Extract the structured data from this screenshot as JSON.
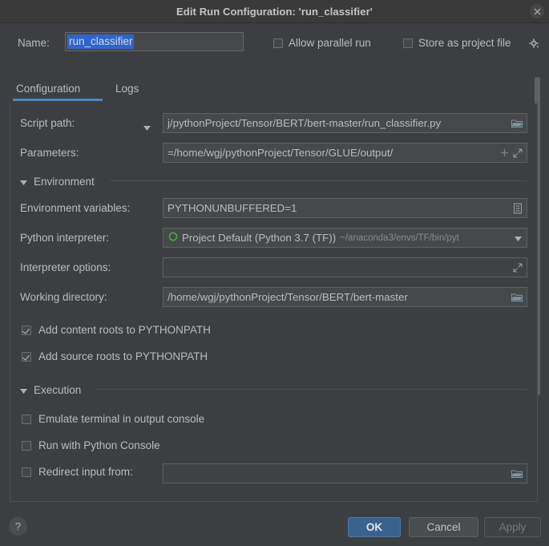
{
  "window": {
    "title": "Edit Run Configuration: 'run_classifier'",
    "close_icon": "close-icon"
  },
  "name_row": {
    "label": "Name:",
    "value": "run_classifier",
    "allow_parallel": {
      "label": "Allow parallel run",
      "checked": false
    },
    "store_as_project_file": {
      "label": "Store as project file",
      "checked": false
    },
    "gear_icon": "gear-icon"
  },
  "tabs": [
    {
      "label": "Configuration",
      "selected": true
    },
    {
      "label": "Logs",
      "selected": false
    }
  ],
  "fields": {
    "script_path": {
      "label": "Script path:",
      "value": "j/pythonProject/Tensor/BERT/bert-master/run_classifier.py",
      "icon": "folder-icon"
    },
    "parameters": {
      "label": "Parameters:",
      "value": "=/home/wgj/pythonProject/Tensor/GLUE/output/",
      "icon_add": "plus-icon",
      "icon_expand": "expand-icon"
    },
    "environment_variables": {
      "label": "Environment variables:",
      "value": "PYTHONUNBUFFERED=1",
      "icon": "list-edit-icon"
    },
    "python_interpreter": {
      "label": "Python interpreter:",
      "value": "Project Default (Python 3.7 (TF))",
      "path_hint": "~/anaconda3/envs/TF/bin/pyt",
      "status_icon": "python-env-circle-icon",
      "icon": "chevron-down-icon"
    },
    "interpreter_options": {
      "label": "Interpreter options:",
      "value": "",
      "icon": "expand-icon"
    },
    "working_directory": {
      "label": "Working directory:",
      "value": "/home/wgj/pythonProject/Tensor/BERT/bert-master",
      "icon": "folder-icon"
    },
    "redirect_input": {
      "label": "Redirect input from:",
      "checked": false,
      "value": "",
      "icon": "folder-icon"
    }
  },
  "sections": {
    "environment": {
      "title": "Environment",
      "expanded": true
    },
    "execution": {
      "title": "Execution",
      "expanded": true
    }
  },
  "checkboxes": {
    "add_content_roots": {
      "label": "Add content roots to PYTHONPATH",
      "checked": true
    },
    "add_source_roots": {
      "label": "Add source roots to PYTHONPATH",
      "checked": true
    },
    "emulate_terminal": {
      "label": "Emulate terminal in output console",
      "checked": false
    },
    "run_with_python_console": {
      "label": "Run with Python Console",
      "checked": false
    }
  },
  "footer": {
    "help_label": "?",
    "ok_label": "OK",
    "cancel_label": "Cancel",
    "apply_label": "Apply"
  },
  "colors": {
    "accent": "#4a88c7",
    "selection": "#2f65ca",
    "ok_button": "#3a628f",
    "background": "#3c3f41",
    "field_background": "#45494a",
    "interpreter_status": "#49a942"
  }
}
